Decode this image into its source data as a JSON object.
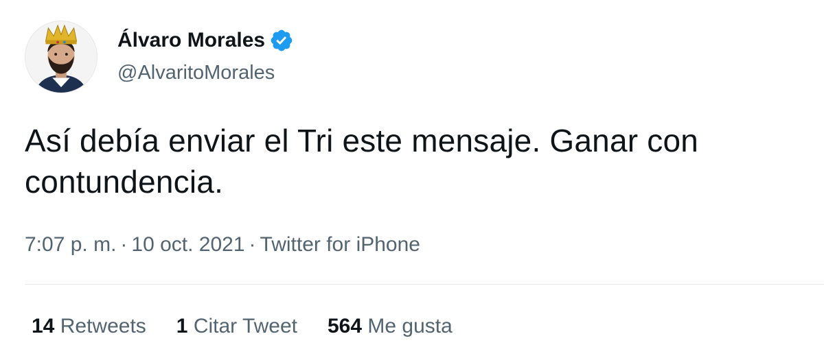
{
  "user": {
    "display_name": "Álvaro Morales",
    "handle": "@AlvaritoMorales",
    "verified_icon": "verified-badge-icon",
    "avatar_icon": "avatar-king-crown"
  },
  "tweet": {
    "text": "Así debía enviar el Tri este mensaje. Ganar con contundencia.",
    "time": "7:07 p. m.",
    "date": "10 oct. 2021",
    "source": "Twitter for iPhone",
    "separator": "·"
  },
  "stats": {
    "retweets_count": "14",
    "retweets_label": "Retweets",
    "quotes_count": "1",
    "quotes_label": "Citar Tweet",
    "likes_count": "564",
    "likes_label": "Me gusta"
  },
  "colors": {
    "text_primary": "#0f1419",
    "text_secondary": "#536471",
    "verified_blue": "#1d9bf0",
    "divider": "#e7e9ea"
  }
}
